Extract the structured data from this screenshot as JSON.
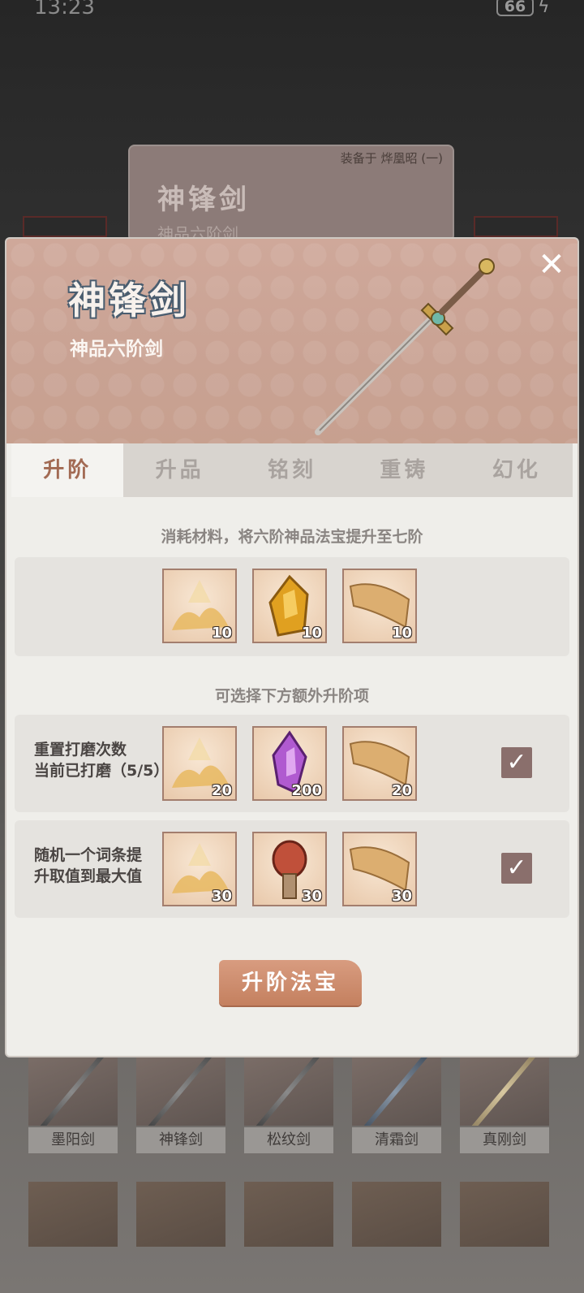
{
  "status_bar": {
    "time": "13:23",
    "battery": "66"
  },
  "background_card": {
    "equipped_tag": "装备于 烨凰昭 (一)",
    "title": "神锋剑",
    "subtitle": "神品六阶剑"
  },
  "modal": {
    "title": "神锋剑",
    "subtitle": "神品六阶剑",
    "close_label": "✕",
    "tabs": [
      {
        "label": "升阶",
        "active": true
      },
      {
        "label": "升品",
        "active": false
      },
      {
        "label": "铭刻",
        "active": false
      },
      {
        "label": "重铸",
        "active": false
      },
      {
        "label": "幻化",
        "active": false
      }
    ],
    "consume_text": "消耗材料，将六阶神品法宝提升至七阶",
    "materials": [
      {
        "icon": "gold-dust-icon",
        "qty": "10"
      },
      {
        "icon": "amber-crystal-icon",
        "qty": "10"
      },
      {
        "icon": "golden-scroll-icon",
        "qty": "10"
      }
    ],
    "optional_text": "可选择下方额外升阶项",
    "options": [
      {
        "text_line1": "重置打磨次数",
        "text_line2": "当前已打磨（5/5）",
        "checked": true,
        "materials": [
          {
            "icon": "gold-dust-icon",
            "qty": "20"
          },
          {
            "icon": "purple-crystal-icon",
            "qty": "200"
          },
          {
            "icon": "golden-scroll-icon",
            "qty": "20"
          }
        ]
      },
      {
        "text_line1": "随机一个词条提",
        "text_line2": "升取值到最大值",
        "checked": true,
        "materials": [
          {
            "icon": "gold-dust-icon",
            "qty": "30"
          },
          {
            "icon": "red-talisman-icon",
            "qty": "30"
          },
          {
            "icon": "golden-scroll-icon",
            "qty": "30"
          }
        ]
      }
    ],
    "checkmark": "✓",
    "action_button": "升阶法宝"
  },
  "weapon_grid": {
    "row1": [
      {
        "label": "墨阳剑"
      },
      {
        "label": "神锋剑"
      },
      {
        "label": "松纹剑"
      },
      {
        "label": "清霜剑"
      },
      {
        "label": "真刚剑"
      }
    ]
  }
}
